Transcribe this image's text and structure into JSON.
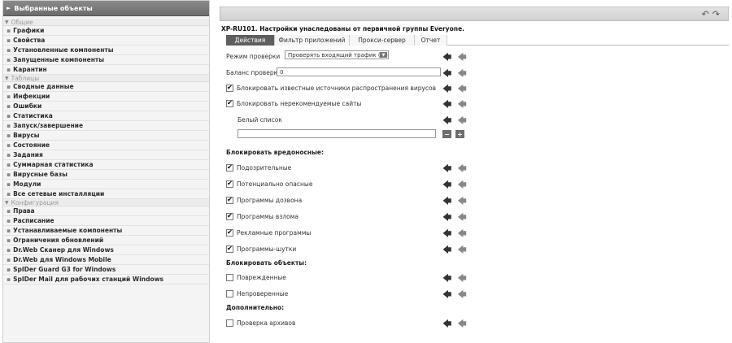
{
  "sidebar": {
    "header": "Выбранные объекты",
    "groups": [
      {
        "title": "Общие",
        "items": [
          "Графики",
          "Свойства",
          "Установленные компоненты",
          "Запущенные компоненты",
          "Карантин"
        ]
      },
      {
        "title": "Таблицы",
        "items": [
          "Сводные данные",
          "Инфекции",
          "Ошибки",
          "Статистика",
          "Запуск/завершение",
          "Вирусы",
          "Состояние",
          "Задания",
          "Суммарная статистика",
          "Вирусные базы",
          "Модули",
          "Все сетевые инсталляции"
        ]
      },
      {
        "title": "Конфигурация",
        "items": [
          "Права",
          "Расписание",
          "Устанавливаемые компоненты",
          "Ограничения обновлений",
          "Dr.Web Сканер для Windows",
          "Dr.Web для Windows Mobile",
          "SpIDer Guard G3 for Windows",
          "SpIDer Mail для рабочих станций Windows"
        ]
      }
    ]
  },
  "header": {
    "title": "XP-RU101. Настройки унаследованы от первичной группы Everyone."
  },
  "tabs": [
    "Действия",
    "Фильтр приложений",
    "Прокси-сервер",
    "Отчет"
  ],
  "form": {
    "check_mode_label": "Режим проверки",
    "check_mode_value": "Проверять входящий трафик (рекомен",
    "balance_label": "Баланс проверки",
    "balance_value": "0",
    "block_virus_sources": "Блокировать известные источники распространения вирусов",
    "block_unrecommended": "Блокировать нерекомендуемые сайты",
    "whitelist_label": "Белый список",
    "whitelist_value": "",
    "malware_section": "Блокировать вредоносные:",
    "malware": [
      "Подозрительные",
      "Потенциально опасные",
      "Программы дозвона",
      "Программы взлома",
      "Рекламные программы",
      "Программы-шутки"
    ],
    "objects_section": "Блокировать объекты:",
    "objects": [
      "Поврежденные",
      "Непроверенные"
    ],
    "extra_section": "Дополнительно:",
    "extra": [
      "Проверка архивов"
    ],
    "minus_label": "−",
    "plus_label": "+"
  }
}
